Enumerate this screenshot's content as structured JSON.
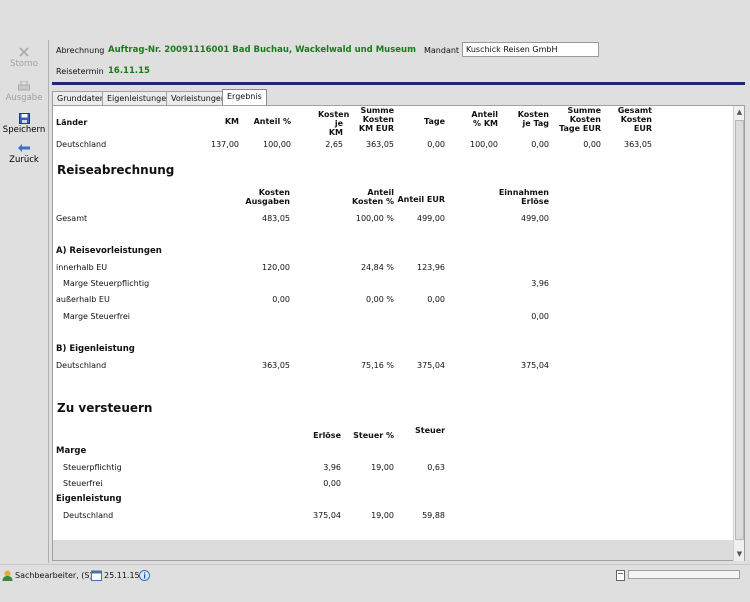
{
  "toolbar": {
    "storno": "Storno",
    "ausgabe": "Ausgabe",
    "speichern": "Speichern",
    "zurueck": "Zurück"
  },
  "header": {
    "abrechnung_label": "Abrechnung",
    "abrechnung_value": "Auftrag-Nr. 20091116001 Bad Buchau, Wackelwald und Museum",
    "reisetermin_label": "Reisetermin",
    "reisetermin_value": "16.11.15",
    "mandant_label": "Mandant",
    "mandant_value": "Kuschick Reisen GmbH"
  },
  "tabs": [
    "Grunddaten",
    "Eigenleistungen",
    "Vorleistungen",
    "Ergebnis"
  ],
  "laender": {
    "headers": {
      "laender": "Länder",
      "km": "KM",
      "anteil": "Anteil %",
      "kosten_km": "Kosten je KM",
      "summe_kosten": "Summe Kosten KM EUR",
      "tage": "Tage",
      "anteil_km": "Anteil % KM",
      "kosten_tag": "Kosten je Tag",
      "summe_tage": "Summe Kosten Tage EUR",
      "gesamt": "Gesamt Kosten EUR"
    },
    "row": {
      "land": "Deutschland",
      "km": "137,00",
      "anteil": "100,00",
      "kosten_km": "2,65",
      "summe_kosten": "363,05",
      "tage": "0,00",
      "anteil_km": "100,00",
      "kosten_tag": "0,00",
      "summe_tage": "0,00",
      "gesamt": "363,05"
    }
  },
  "reise": {
    "title": "Reiseabrechnung",
    "h_kosten": "Kosten Ausgaben",
    "h_anteil_kosten": "Anteil Kosten %",
    "h_anteil_eur": "Anteil EUR",
    "h_einnahmen": "Einnahmen Erlöse",
    "gesamt_label": "Gesamt",
    "gesamt_kosten": "483,05",
    "gesamt_anteil": "100,00 %",
    "gesamt_eur": "499,00",
    "gesamt_einnahmen": "499,00",
    "a_title": "A) Reisevorleistungen",
    "innerhalb_label": "innerhalb EU",
    "innerhalb_kosten": "120,00",
    "innerhalb_anteil": "24,84 %",
    "innerhalb_eur": "123,96",
    "marge_pflichtig_label": "Marge Steuerpflichtig",
    "marge_pflichtig_value": "3,96",
    "ausserhalb_label": "außerhalb EU",
    "ausserhalb_kosten": "0,00",
    "ausserhalb_anteil": "0,00 %",
    "ausserhalb_eur": "0,00",
    "marge_frei_label": "Marge Steuerfrei",
    "marge_frei_value": "0,00",
    "b_title": "B) Eigenleistung",
    "deutschland_label": "Deutschland",
    "deutschland_kosten": "363,05",
    "deutschland_anteil": "75,16 %",
    "deutschland_eur": "375,04",
    "deutschland_einnahmen": "375,04"
  },
  "versteuern": {
    "title": "Zu versteuern",
    "h_erloese": "Erlöse",
    "h_steuer_pct": "Steuer %",
    "h_steuer_eur": "Steuer EUR",
    "marge_label": "Marge",
    "steuerpflichtig_label": "Steuerpflichtig",
    "steuerpflichtig_erloese": "3,96",
    "steuerpflichtig_pct": "19,00",
    "steuerpflichtig_eur": "0,63",
    "steuerfrei_label": "Steuerfrei",
    "steuerfrei_erloese": "0,00",
    "eigen_label": "Eigenleistung",
    "deutschland_label": "Deutschland",
    "deutschland_erloese": "375,04",
    "deutschland_pct": "19,00",
    "deutschland_eur": "59,88"
  },
  "status": {
    "user": "Sachbearbeiter, (S)",
    "date": "25.11.15"
  }
}
